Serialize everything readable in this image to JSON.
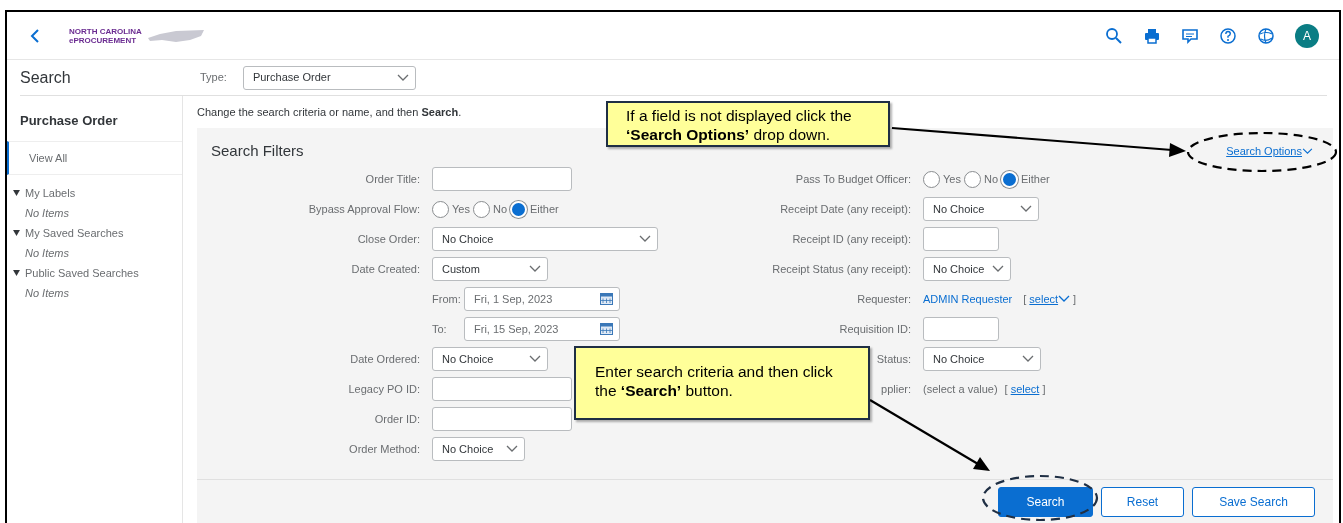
{
  "header": {
    "logo_text": [
      "NORTH CAROLINA",
      "ePROCUREMENT"
    ],
    "avatar": "A"
  },
  "page_title": "Search",
  "type_field": {
    "label": "Type:",
    "value": "Purchase Order"
  },
  "sidebar": {
    "title": "Purchase Order",
    "items": [
      {
        "label": "View All",
        "selected": true
      }
    ],
    "groups": [
      {
        "label": "My Labels",
        "expanded": true,
        "empty_text": "No Items"
      },
      {
        "label": "My Saved Searches",
        "expanded": true,
        "empty_text": "No Items"
      },
      {
        "label": "Public Saved Searches",
        "expanded": true,
        "empty_text": "No Items"
      }
    ]
  },
  "instruction": "Change the search criteria or name, and then **Search**.",
  "filters": {
    "title": "Search Filters",
    "search_options": "Search Options",
    "left": [
      {
        "label": "Order Title:",
        "kind": "text"
      },
      {
        "label": "Bypass Approval Flow:",
        "kind": "radio",
        "options": [
          {
            "label": "Yes",
            "selected": false
          },
          {
            "label": "No",
            "selected": false
          },
          {
            "label": "Either",
            "selected": true
          }
        ]
      },
      {
        "label": "Close Order:",
        "kind": "select",
        "value": "No Choice"
      },
      {
        "label": "Date Created:",
        "kind": "select",
        "value": "Custom"
      },
      {
        "label": "From:",
        "kind": "date",
        "value": "Fri, 1 Sep, 2023"
      },
      {
        "label": "To:",
        "kind": "date",
        "value": "Fri, 15 Sep, 2023"
      },
      {
        "label": "Date Ordered:",
        "kind": "select",
        "value": "No Choice"
      },
      {
        "label": "Legacy PO ID:",
        "kind": "text"
      },
      {
        "label": "Order ID:",
        "kind": "text"
      },
      {
        "label": "Order Method:",
        "kind": "select",
        "value": "No Choice"
      }
    ],
    "right": [
      {
        "label": "Pass To Budget Officer:",
        "kind": "radio",
        "options": [
          {
            "label": "Yes",
            "selected": false
          },
          {
            "label": "No",
            "selected": false
          },
          {
            "label": "Either",
            "selected": true
          }
        ]
      },
      {
        "label": "Receipt Date (any receipt):",
        "kind": "select",
        "value": "No Choice"
      },
      {
        "label": "Receipt ID (any receipt):",
        "kind": "text"
      },
      {
        "label": "Receipt Status (any receipt):",
        "kind": "select",
        "value": "No Choice"
      },
      {
        "label": "Requester:",
        "kind": "chooser",
        "value": "ADMIN Requester",
        "value_is_link": true,
        "bracket_open": "[",
        "action": "select",
        "caret": true,
        "bracket_close": "]"
      },
      {
        "label": "Requisition ID:",
        "kind": "text"
      },
      {
        "label": "Status:",
        "kind": "select",
        "value": "No Choice"
      },
      {
        "label": "pplier:",
        "kind": "chooser",
        "value": "(select a value)",
        "value_is_link": false,
        "bracket_open": "[",
        "action": "select",
        "caret": false,
        "bracket_close": "]"
      }
    ]
  },
  "buttons": [
    {
      "label": "Search",
      "kind": "primary"
    },
    {
      "label": "Reset",
      "kind": "secondary"
    },
    {
      "label": "Save Search",
      "kind": "secondary"
    }
  ],
  "callouts": [
    {
      "text": "If a field is not displayed click the **‘Search Options’** drop down."
    },
    {
      "text": "Enter search criteria and then click the **‘Search’** button."
    }
  ]
}
